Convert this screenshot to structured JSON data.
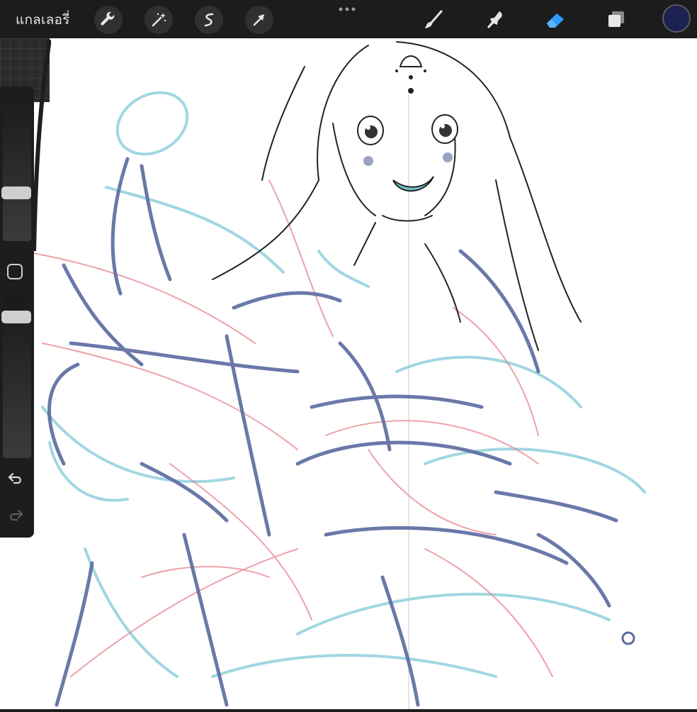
{
  "toolbar": {
    "gallery_label": "แกลเลอรี่",
    "left_tools": [
      "wrench-icon",
      "magic-wand-icon",
      "selection-icon",
      "transform-arrow-icon"
    ],
    "right_tools": [
      "brush-icon",
      "smudge-icon",
      "eraser-icon",
      "layers-icon"
    ],
    "active_tool": "eraser",
    "current_color": "#1c2250",
    "accent_color": "#2d9cff"
  },
  "sidebar": {
    "brush_size_level": 0.55,
    "opacity_level": 0.95
  },
  "canvas": {
    "content": "sketch-artwork"
  }
}
